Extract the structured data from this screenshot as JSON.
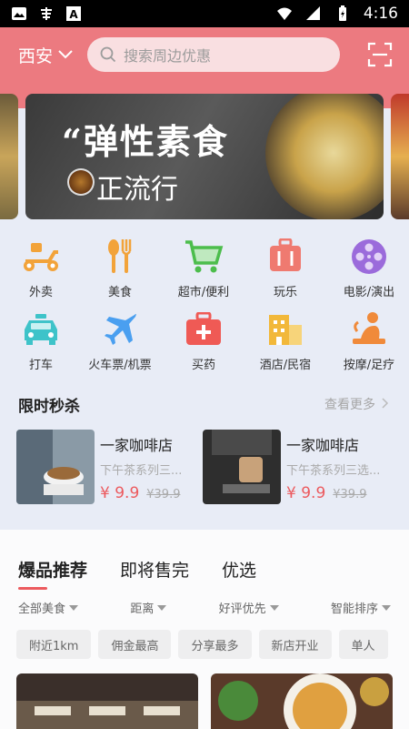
{
  "status_bar": {
    "time": "4:16"
  },
  "header": {
    "city": "西安",
    "search_placeholder": "搜索周边优惠"
  },
  "banner": {
    "title": "“弹性素食",
    "subtitle": "正流行"
  },
  "categories": [
    {
      "label": "外卖",
      "icon": "scooter-icon",
      "color": "#f2a33a"
    },
    {
      "label": "美食",
      "icon": "fork-spoon-icon",
      "color": "#f2a33a"
    },
    {
      "label": "超市/便利",
      "icon": "cart-icon",
      "color": "#4cbd4c"
    },
    {
      "label": "玩乐",
      "icon": "suitcase-icon",
      "color": "#ef7a70"
    },
    {
      "label": "电影/演出",
      "icon": "film-reel-icon",
      "color": "#9b6bdb"
    },
    {
      "label": "打车",
      "icon": "taxi-icon",
      "color": "#3ec3c9"
    },
    {
      "label": "火车票/机票",
      "icon": "airplane-icon",
      "color": "#4a9ff0"
    },
    {
      "label": "买药",
      "icon": "medicine-box-icon",
      "color": "#ef5a55"
    },
    {
      "label": "酒店/民宿",
      "icon": "hotel-icon",
      "color": "#f2b83a"
    },
    {
      "label": "按摩/足疗",
      "icon": "massage-icon",
      "color": "#f08a3a"
    }
  ],
  "flash_sale": {
    "title": "限时秒杀",
    "more": "查看更多",
    "deals": [
      {
        "name": "一家咖啡店",
        "desc": "下午茶系列三...",
        "price": "¥ 9.9",
        "original": "¥39.9"
      },
      {
        "name": "一家咖啡店",
        "desc": "下午茶系列三选...",
        "price": "¥ 9.9",
        "original": "¥39.9"
      }
    ]
  },
  "recommend": {
    "tabs": [
      "爆品推荐",
      "即将售完",
      "优选"
    ],
    "filters": [
      "全部美食",
      "距离",
      "好评优先",
      "智能排序"
    ],
    "chips": [
      "附近1km",
      "佣金最高",
      "分享最多",
      "新店开业",
      "单人"
    ]
  },
  "colors": {
    "brand": "#ec7a80",
    "price": "#ec5a5e"
  }
}
